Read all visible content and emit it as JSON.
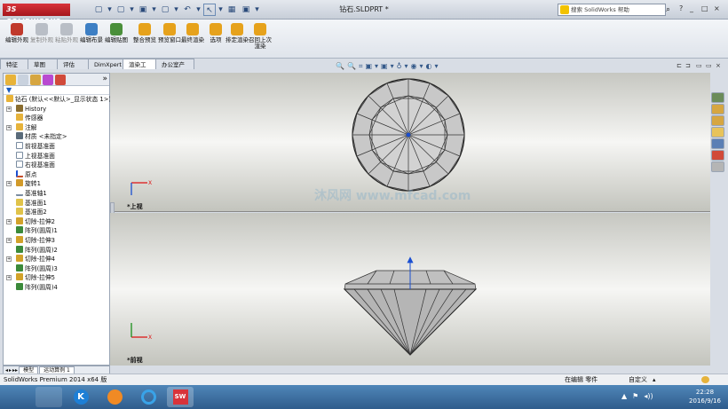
{
  "app": {
    "logo_text": "3S SOLIDWORKS",
    "document_title": "钻石.SLDPRT *",
    "search_placeholder": "搜索 SolidWorks 帮助",
    "search_go": "⌕",
    "help_icon": "?",
    "window_controls": [
      "_",
      "□",
      "×"
    ]
  },
  "quick_access": [
    "▢",
    "▾",
    "▢",
    "▾",
    "▣",
    "▾",
    "▢",
    "▾",
    "↶",
    "▾",
    "↖",
    "▾",
    "▦",
    "▣",
    "▾"
  ],
  "ribbon": {
    "buttons": [
      {
        "label": "编辑外观",
        "color": "#c0392b",
        "enabled": true
      },
      {
        "label": "复制外观",
        "color": "#8a8f98",
        "enabled": false
      },
      {
        "label": "粘贴外观",
        "color": "#8a8f98",
        "enabled": false
      },
      {
        "label": "编辑布景",
        "color": "#3d7fc4",
        "enabled": true
      },
      {
        "label": "编辑贴图",
        "color": "#4a8f3a",
        "enabled": true
      },
      {
        "label": "整合预览",
        "color": "#e6a21c",
        "enabled": true
      },
      {
        "label": "预览窗口",
        "color": "#e6a21c",
        "enabled": true
      },
      {
        "label": "最终渲染",
        "color": "#e6a21c",
        "enabled": true
      },
      {
        "label": "选项",
        "color": "#e6a21c",
        "enabled": true
      },
      {
        "label": "排定渲染",
        "color": "#e6a21c",
        "enabled": true
      },
      {
        "label": "召回上次渲染",
        "color": "#e6a21c",
        "enabled": true
      }
    ]
  },
  "command_tabs": [
    {
      "label": "特征",
      "active": false
    },
    {
      "label": "草图",
      "active": false
    },
    {
      "label": "评估",
      "active": false
    },
    {
      "label": "DimXpert",
      "active": false
    },
    {
      "label": "渲染工具",
      "active": true
    },
    {
      "label": "办公室产品",
      "active": false
    }
  ],
  "view_toolbar": [
    "🔍",
    "🔍",
    "⌗",
    "▣",
    "▾",
    "▣",
    "▾",
    "♁",
    "▾",
    "◉",
    "▾",
    "◐",
    "▾"
  ],
  "viewport_controls": [
    "⊏",
    "⊐",
    "▭",
    "▭",
    "×"
  ],
  "feature_tree": {
    "expand_arrow": "»",
    "root": "钻石 (默认<<默认>_显示状态 1>)",
    "items": [
      {
        "label": "History",
        "icon_color": "#8a6d2f",
        "expandable": true
      },
      {
        "label": "传感器",
        "icon_color": "#e6b33c",
        "expandable": false
      },
      {
        "label": "注解",
        "icon_color": "#e6b33c",
        "expandable": true
      },
      {
        "label": "材质 <未指定>",
        "icon_color": "#5a6b7a",
        "expandable": false
      },
      {
        "label": "前视基准面",
        "icon_color": "#7a8ca0",
        "expandable": false
      },
      {
        "label": "上视基准面",
        "icon_color": "#7a8ca0",
        "expandable": false
      },
      {
        "label": "右视基准面",
        "icon_color": "#7a8ca0",
        "expandable": false
      },
      {
        "label": "原点",
        "icon_color": "#c44b2a",
        "expandable": false
      },
      {
        "label": "旋转1",
        "icon_color": "#d29a2a",
        "expandable": true
      },
      {
        "label": "基准轴1",
        "icon_color": "#7a8ca0",
        "expandable": false
      },
      {
        "label": "基准面1",
        "icon_color": "#e0c34a",
        "expandable": false
      },
      {
        "label": "基准面2",
        "icon_color": "#e0c34a",
        "expandable": false
      },
      {
        "label": "切除-拉伸2",
        "icon_color": "#d2a22a",
        "expandable": true
      },
      {
        "label": "阵列(圆周)1",
        "icon_color": "#3b8a3a",
        "expandable": false
      },
      {
        "label": "切除-拉伸3",
        "icon_color": "#d2a22a",
        "expandable": true
      },
      {
        "label": "阵列(圆周)2",
        "icon_color": "#3b8a3a",
        "expandable": false
      },
      {
        "label": "切除-拉伸4",
        "icon_color": "#d2a22a",
        "expandable": true
      },
      {
        "label": "阵列(圆周)3",
        "icon_color": "#3b8a3a",
        "expandable": false
      },
      {
        "label": "切除-拉伸5",
        "icon_color": "#d2a22a",
        "expandable": true
      },
      {
        "label": "阵列(圆周)4",
        "icon_color": "#3b8a3a",
        "expandable": false
      }
    ]
  },
  "bottom_tabs": {
    "arrows": [
      "◂",
      "▸",
      "▸▸"
    ],
    "items": [
      "模型",
      "运动算例 1"
    ]
  },
  "viewports": {
    "top_label": "*上视",
    "bottom_label": "*前视"
  },
  "watermark": "沐风网 www.mfcad.com",
  "status_bar": {
    "left": "SolidWorks Premium 2014 x64 版",
    "mode": "在编辑 零件",
    "units": "自定义",
    "units_arrow": "▴"
  },
  "taskbar": {
    "tray_icons": [
      "▲",
      "⚑",
      "◂))"
    ],
    "time": "22:28",
    "date": "2016/9/16"
  },
  "colors": {
    "accent": "#2f5c8c",
    "selection": "#1a4fd1"
  }
}
